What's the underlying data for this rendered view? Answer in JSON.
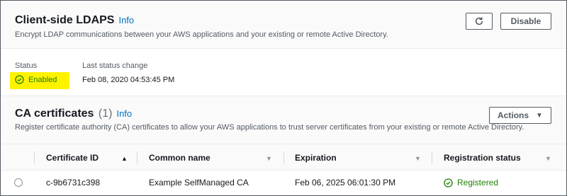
{
  "ldaps": {
    "title": "Client-side LDAPS",
    "info_label": "Info",
    "description": "Encrypt LDAP communications between your AWS applications and your existing or remote Active Directory.",
    "refresh_icon": "refresh-icon",
    "disable_label": "Disable",
    "status_label": "Status",
    "status_value": "Enabled",
    "status_icon": "check-circle-icon",
    "status_color": "#1d8102",
    "highlight_color": "#fff200",
    "last_change_label": "Last status change",
    "last_change_value": "Feb 08, 2020 04:53:45 PM"
  },
  "ca": {
    "title": "CA certificates",
    "count": "(1)",
    "info_label": "Info",
    "description": "Register certificate authority (CA) certificates to allow your AWS applications to trust server certificates from your existing or remote Active Directory.",
    "actions_label": "Actions",
    "table": {
      "columns": [
        "Certificate ID",
        "Common name",
        "Expiration",
        "Registration status"
      ],
      "sorted_column": "Certificate ID",
      "rows": [
        {
          "certificate_id": "c-9b6731c398",
          "common_name": "Example SelfManaged CA",
          "expiration": "Feb 06, 2025 06:01:30 PM",
          "registration_status": "Registered"
        }
      ]
    }
  },
  "colors": {
    "link": "#0073bb",
    "success": "#1d8102",
    "text": "#16191f",
    "muted": "#545b64"
  }
}
